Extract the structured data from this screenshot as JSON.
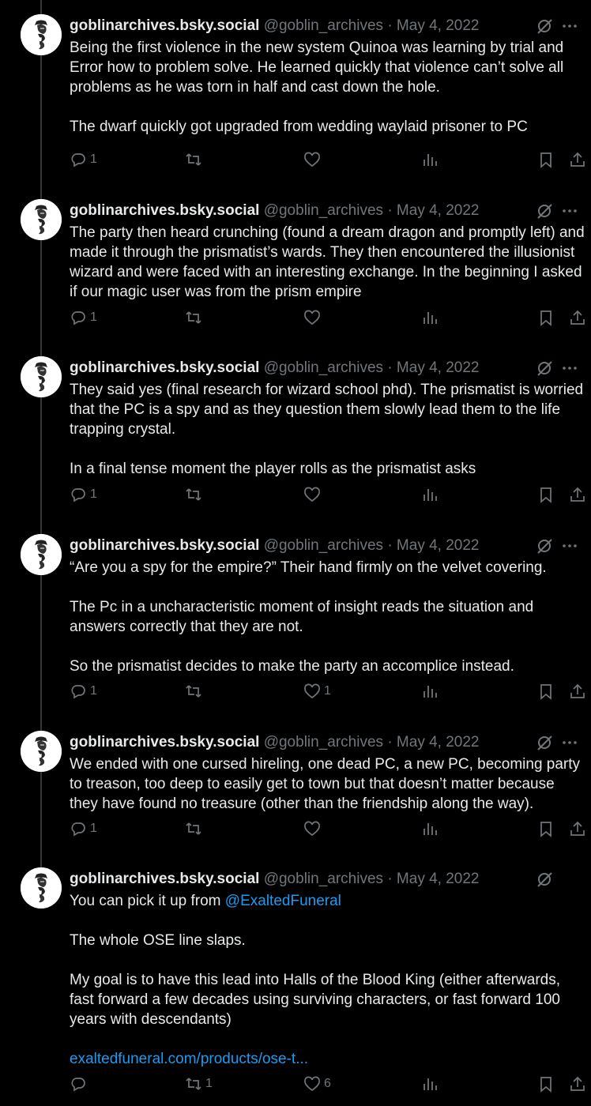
{
  "author": {
    "name": "goblinarchives.bsky.social",
    "handle": "@goblin_archives",
    "separator": "·"
  },
  "tweets": [
    {
      "date": "May 4, 2022",
      "paragraphs": [
        "Being the first violence in the new system Quinoa was learning by trial and Error how to problem solve. He learned quickly that violence can’t solve all problems as he was torn in half and cast down the hole.",
        "The dwarf quickly got upgraded from wedding waylaid prisoner to PC"
      ],
      "replies": "1",
      "reposts": "",
      "likes": ""
    },
    {
      "date": "May 4, 2022",
      "paragraphs": [
        "The party then heard crunching (found a dream dragon and promptly left) and made it through the prismatist’s wards. They then encountered the illusionist wizard and were faced with an interesting exchange. In the beginning I asked if our magic user was from the prism empire"
      ],
      "replies": "1",
      "reposts": "",
      "likes": ""
    },
    {
      "date": "May 4, 2022",
      "paragraphs": [
        "They said yes (final research for wizard school phd). The prismatist is worried that the PC is a spy and as they question them slowly lead them to the life trapping crystal.",
        "In a final tense moment the player rolls as the prismatist asks"
      ],
      "replies": "1",
      "reposts": "",
      "likes": ""
    },
    {
      "date": "May 4, 2022",
      "paragraphs": [
        "“Are you a spy for the empire?” Their hand firmly on the velvet covering.",
        "The Pc in a uncharacteristic moment of insight reads the situation and answers correctly that they are not.",
        "So the prismatist decides to make the party an accomplice instead."
      ],
      "replies": "1",
      "reposts": "",
      "likes": "1"
    },
    {
      "date": "May 4, 2022",
      "paragraphs": [
        "We ended with one cursed hireling, one dead PC, a new PC, becoming party to treason, too deep to easily get to town but that doesn’t matter because they have found no treasure (other than the friendship along the way)."
      ],
      "replies": "1",
      "reposts": "",
      "likes": ""
    },
    {
      "date": "May 4, 2022",
      "intro": "You can pick it up from ",
      "mention": "@ExaltedFuneral",
      "paragraphs": [
        "The whole OSE line slaps.",
        "My goal is to have this lead into Halls of the Blood King (either afterwards, fast forward a few decades using surviving characters, or fast forward 100 years with descendants)"
      ],
      "url": "exaltedfuneral.com/products/ose-t...",
      "replies": "",
      "reposts": "1",
      "likes": "6"
    }
  ]
}
